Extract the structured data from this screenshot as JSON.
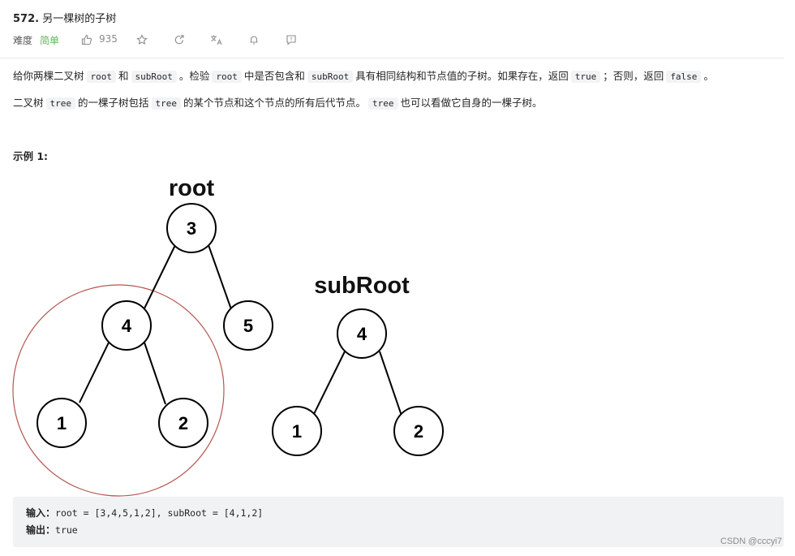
{
  "problem": {
    "number": "572.",
    "title": "另一棵树的子树",
    "difficulty_label": "难度",
    "difficulty": "简单",
    "likes": "935",
    "difficulty_color": "#5cb85c"
  },
  "toolbar_icons": [
    "thumbs-up-icon",
    "star-icon",
    "share-icon",
    "translate-icon",
    "bell-icon",
    "feedback-icon"
  ],
  "description": {
    "p1": {
      "t1": "给你两棵二叉树",
      "c1": "root",
      "t2": "和",
      "c2": "subRoot",
      "t3": "。检验",
      "c3": "root",
      "t4": "中是否包含和",
      "c4": "subRoot",
      "t5": "具有相同结构和节点值的子树。如果存在，返回",
      "c5": "true",
      "t6": "；否则，返回",
      "c6": "false",
      "t7": "。"
    },
    "p2": {
      "t1": "二叉树",
      "c1": "tree",
      "t2": "的一棵子树包括",
      "c2": "tree",
      "t3": "的某个节点和这个节点的所有后代节点。",
      "c3": "tree",
      "t4": "也可以看做它自身的一棵子树。"
    }
  },
  "example": {
    "heading": "示例 1:",
    "diagram": {
      "root_label": "root",
      "subroot_label": "subRoot",
      "root_tree": {
        "nodes": [
          "3",
          "4",
          "5",
          "1",
          "2"
        ],
        "highlighted_subtree_root": "4"
      },
      "subroot_tree": {
        "nodes": [
          "4",
          "1",
          "2"
        ]
      },
      "highlight_color": "#b5574f"
    },
    "input_label": "输入：",
    "input_value": "root = [3,4,5,1,2], subRoot = [4,1,2]",
    "output_label": "输出：",
    "output_value": "true"
  },
  "watermark": "CSDN @cccyi7"
}
